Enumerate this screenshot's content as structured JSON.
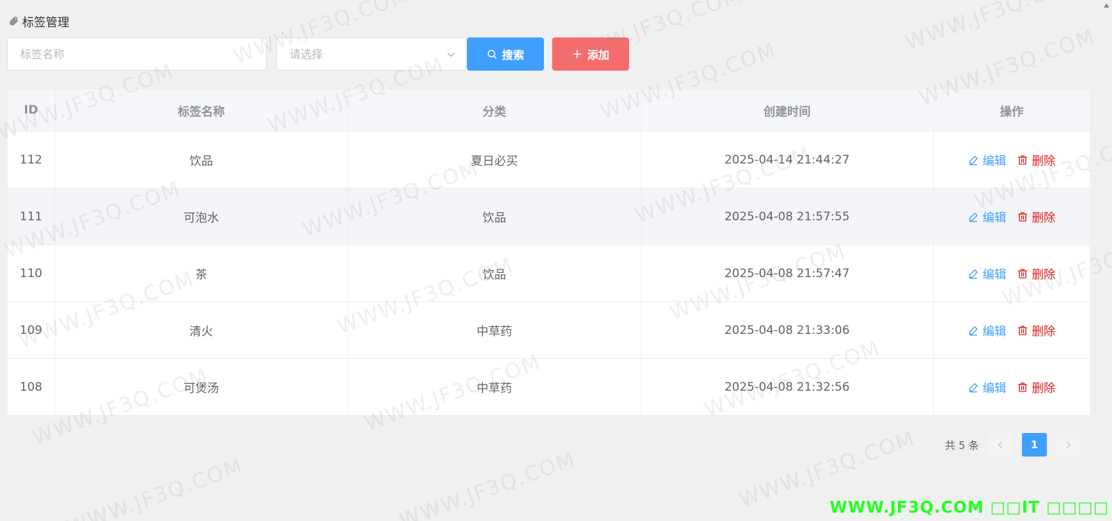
{
  "page": {
    "title": "标签管理"
  },
  "filters": {
    "name_placeholder": "标签名称",
    "category_placeholder": "请选择",
    "search_label": "搜索",
    "add_label": "添加"
  },
  "table": {
    "headers": {
      "id": "ID",
      "name": "标签名称",
      "category": "分类",
      "created": "创建时间",
      "actions": "操作"
    },
    "rows": [
      {
        "id": "112",
        "name": "饮品",
        "category": "夏日必买",
        "created": "2025-04-14 21:44:27"
      },
      {
        "id": "111",
        "name": "可泡水",
        "category": "饮品",
        "created": "2025-04-08 21:57:55"
      },
      {
        "id": "110",
        "name": "茶",
        "category": "饮品",
        "created": "2025-04-08 21:57:47"
      },
      {
        "id": "109",
        "name": "清火",
        "category": "中草药",
        "created": "2025-04-08 21:33:06"
      },
      {
        "id": "108",
        "name": "可煲汤",
        "category": "中草药",
        "created": "2025-04-08 21:32:56"
      }
    ],
    "edit_label": "编辑",
    "delete_label": "删除"
  },
  "pagination": {
    "total_text": "共 5 条",
    "current_page": "1"
  },
  "watermark": {
    "text": "WWW.JF3Q.COM",
    "corner_text": "WWW.JF3Q.COM □□IT □□□□"
  },
  "colors": {
    "primary": "#409eff",
    "danger": "#f56c6c",
    "delete_text": "#e02020",
    "watermark_corner": "#22ff22"
  },
  "icons": {
    "title": "paperclip-icon",
    "search": "search-icon",
    "add": "plus-icon",
    "edit": "edit-icon",
    "delete": "trash-icon"
  }
}
